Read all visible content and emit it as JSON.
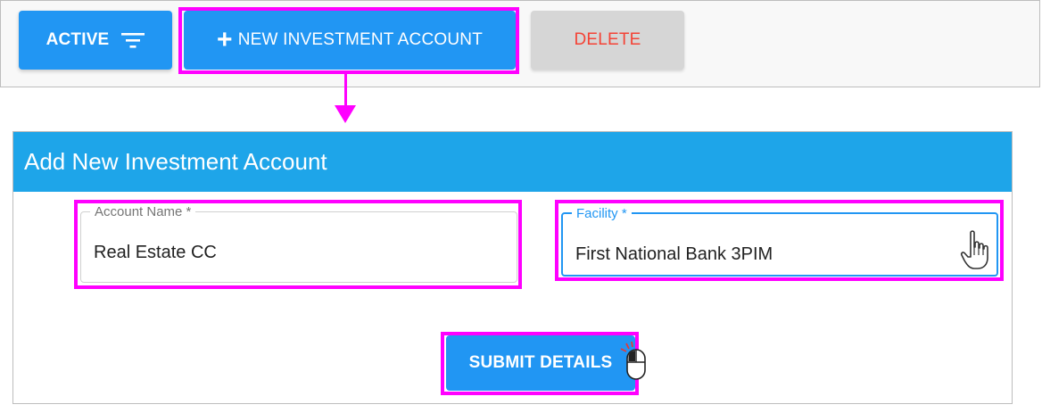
{
  "toolbar": {
    "active_label": "ACTIVE",
    "new_account_label": "NEW INVESTMENT ACCOUNT",
    "delete_label": "DELETE"
  },
  "dialog": {
    "title": "Add New Investment Account",
    "account_name": {
      "label": "Account Name *",
      "value": "Real Estate CC"
    },
    "facility": {
      "label": "Facility *",
      "value": "First National Bank 3PIM"
    },
    "submit_label": "SUBMIT DETAILS"
  },
  "colors": {
    "primary": "#2196f3",
    "header": "#1ea5e9",
    "delete_text": "#f44336",
    "annotation": "#ff00ff"
  },
  "icons": [
    "filter-icon",
    "plus-icon",
    "hand-pointer-icon",
    "mouse-click-icon"
  ]
}
